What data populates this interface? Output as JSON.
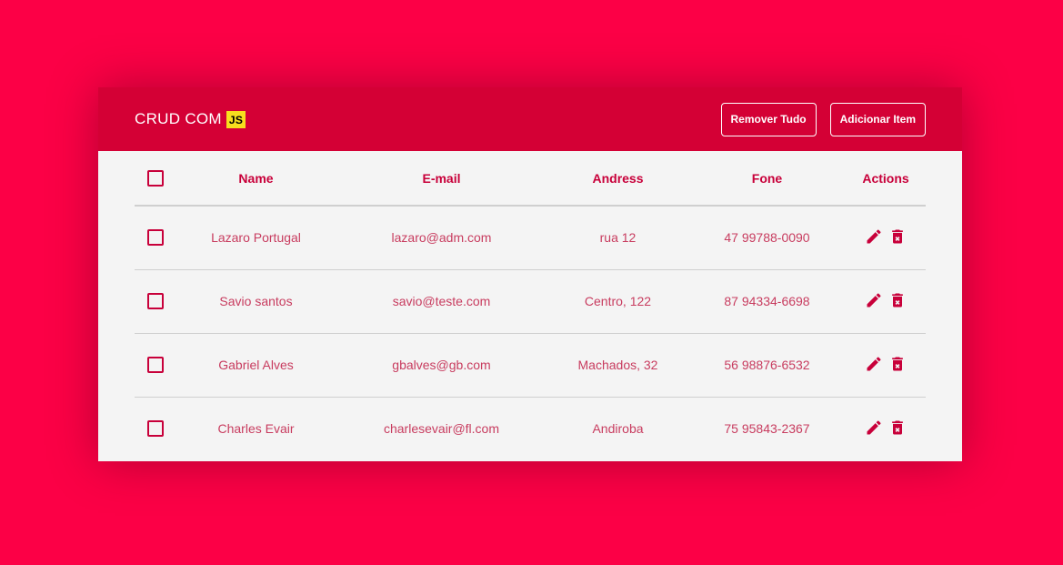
{
  "header": {
    "title": "CRUD COM",
    "badge": "JS",
    "buttons": {
      "remove_all": "Remover Tudo",
      "add_item": "Adicionar Item"
    }
  },
  "table": {
    "columns": {
      "name": "Name",
      "email": "E-mail",
      "address": "Andress",
      "phone": "Fone",
      "actions": "Actions"
    },
    "rows": [
      {
        "name": "Lazaro Portugal",
        "email": "lazaro@adm.com",
        "address": "rua 12",
        "phone": "47 99788-0090"
      },
      {
        "name": "Savio santos",
        "email": "savio@teste.com",
        "address": "Centro, 122",
        "phone": "87 94334-6698"
      },
      {
        "name": "Gabriel Alves",
        "email": "gbalves@gb.com",
        "address": "Machados, 32",
        "phone": "56 98876-6532"
      },
      {
        "name": "Charles Evair",
        "email": "charlesevair@fl.com",
        "address": "Andiroba",
        "phone": "75 95843-2367"
      }
    ]
  },
  "icons": {
    "edit": "pencil-icon",
    "delete": "trash-icon"
  },
  "colors": {
    "background": "#fc0046",
    "header": "#d40035",
    "accent": "#c8003a",
    "badge": "#f7df1e"
  }
}
